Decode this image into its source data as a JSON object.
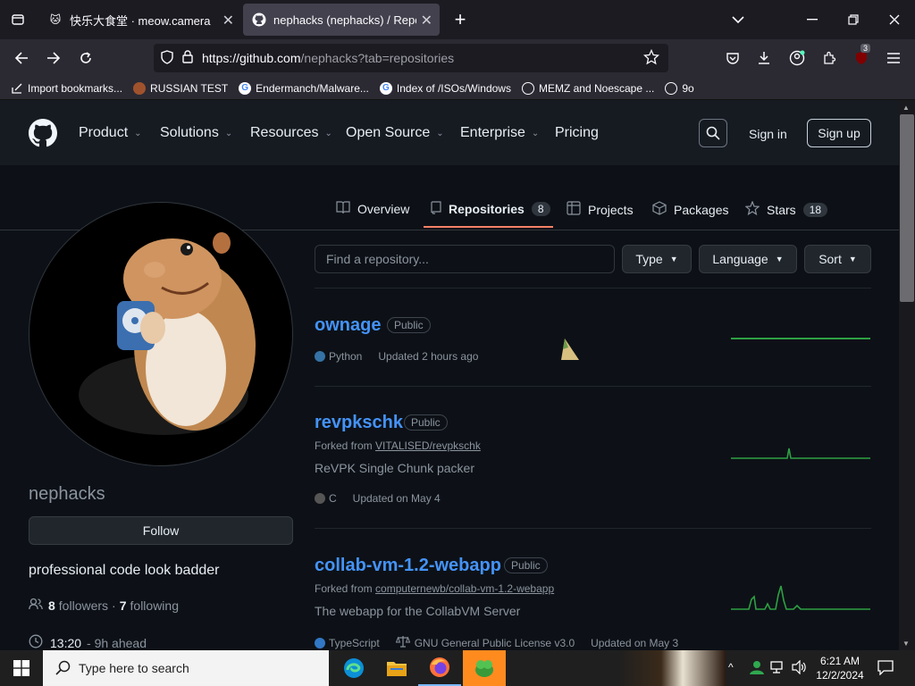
{
  "browser": {
    "tabs": [
      {
        "title": "快乐大食堂 · meow.camera",
        "active": false
      },
      {
        "title": "nephacks (nephacks) / Repositories",
        "active": true
      }
    ],
    "url_host": "https://github.com",
    "url_path": "/nephacks?tab=repositories",
    "extension_badge": "3",
    "bookmarks": [
      "Import bookmarks...",
      "RUSSIAN TEST",
      "Endermanch/Malware...",
      "Index of /ISOs/Windows",
      "MEMZ and Noescape ...",
      "9o"
    ]
  },
  "github_header": {
    "nav": [
      "Product",
      "Solutions",
      "Resources",
      "Open Source",
      "Enterprise",
      "Pricing"
    ],
    "sign_in": "Sign in",
    "sign_up": "Sign up"
  },
  "profile_tabs": {
    "overview": "Overview",
    "repositories": "Repositories",
    "repositories_count": "8",
    "projects": "Projects",
    "packages": "Packages",
    "stars": "Stars",
    "stars_count": "18"
  },
  "profile": {
    "login": "nephacks",
    "follow_label": "Follow",
    "bio": "professional code look badder",
    "followers_count": "8",
    "followers_label": "followers",
    "separator": "·",
    "following_count": "7",
    "following_label": "following",
    "local_time": "13:20",
    "time_offset": "- 9h ahead"
  },
  "filters": {
    "find_placeholder": "Find a repository...",
    "type": "Type",
    "language": "Language",
    "sort": "Sort"
  },
  "repos": [
    {
      "name": "ownage",
      "visibility": "Public",
      "forked_prefix": "",
      "forked_from": "",
      "description": "",
      "language": "Python",
      "language_color": "#3572A5",
      "license": "",
      "updated": "Updated 2 hours ago"
    },
    {
      "name": "revpkschk",
      "visibility": "Public",
      "forked_prefix": "Forked from",
      "forked_from": "VITALISED/revpkschk",
      "description": "ReVPK Single Chunk packer",
      "language": "C",
      "language_color": "#555555",
      "license": "",
      "updated": "Updated on May 4"
    },
    {
      "name": "collab-vm-1.2-webapp",
      "visibility": "Public",
      "forked_prefix": "Forked from",
      "forked_from": "computernewb/collab-vm-1.2-webapp",
      "description": "The webapp for the CollabVM Server",
      "language": "TypeScript",
      "language_color": "#3178c6",
      "license": "GNU General Public License v3.0",
      "updated": "Updated on May 3"
    }
  ],
  "taskbar": {
    "search_placeholder": "Type here to search",
    "time": "6:21 AM",
    "date": "12/2/2024"
  },
  "colors": {
    "accent_link": "#4493f8",
    "tab_underline": "#f78166",
    "spark_green": "#2ea043"
  }
}
